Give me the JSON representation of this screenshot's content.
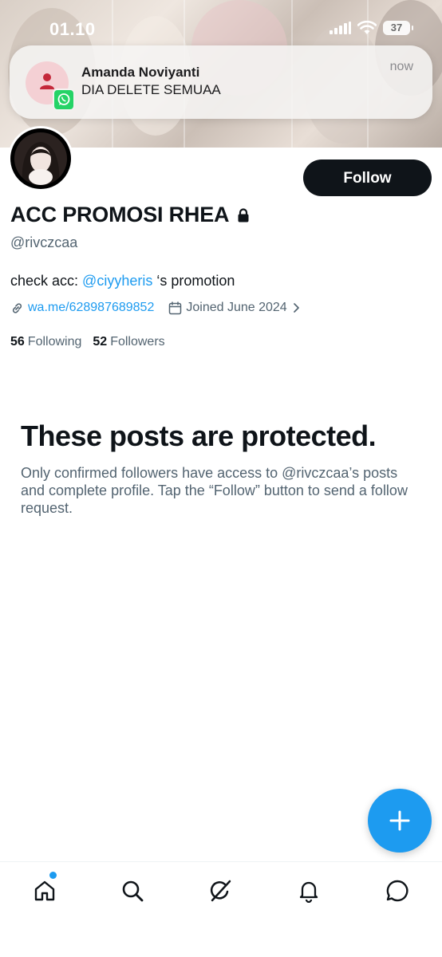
{
  "status_bar": {
    "time": "01.10",
    "battery": "37"
  },
  "notification": {
    "app_icon": "whatsapp-icon",
    "sender": "Amanda Noviyanti",
    "message": "DIA DELETE SEMUAA",
    "time": "now"
  },
  "profile": {
    "follow_label": "Follow",
    "display_name": "ACC PROMOSI RHEA",
    "handle": "@rivczcaa",
    "bio_prefix": "check acc: ",
    "bio_mention": "@ciyyheris",
    "bio_suffix": " ‘s promotion",
    "link": "wa.me/628987689852",
    "joined": "Joined June 2024",
    "following_count": "56",
    "following_label": "Following",
    "followers_count": "52",
    "followers_label": "Followers"
  },
  "protected": {
    "title": "These posts are protected.",
    "text": "Only confirmed followers have access to @rivczcaa’s posts and complete profile. Tap the “Follow” button to send a follow request."
  },
  "bottom_nav": {
    "items": [
      "home-icon",
      "search-icon",
      "grok-icon",
      "notifications-icon",
      "messages-icon"
    ]
  },
  "colors": {
    "accent": "#1d9bf0",
    "text_primary": "#0f1419",
    "text_secondary": "#536471",
    "follow_button": "#0f1419"
  }
}
